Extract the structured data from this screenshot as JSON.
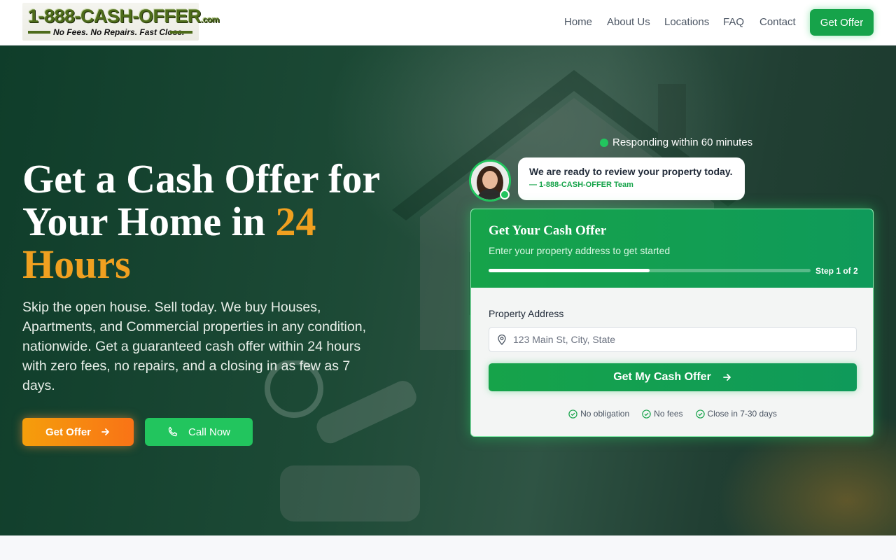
{
  "brand": {
    "logo_main": "1-888-CASH-OFFER",
    "logo_suffix": ".com",
    "logo_tagline": "No Fees. No Repairs. Fast Close."
  },
  "nav": {
    "items": [
      "Home",
      "About Us",
      "Locations",
      "FAQ",
      "Contact"
    ],
    "cta_label": "Get Offer"
  },
  "hero": {
    "title_line1": "Get a Cash Offer for",
    "title_line2_prefix": "Your Home in ",
    "title_highlight_1": "24",
    "title_highlight_2": "Hours",
    "subtitle": "Skip the open house. Sell today. We buy Houses, Apartments, and Commercial properties in any condition, nationwide. Get a guaranteed cash offer within 24 hours with zero fees, no repairs, and a closing in as few as 7 days.",
    "primary_button": "Get Offer",
    "secondary_button": "Call Now",
    "accent_color": "#f0a020"
  },
  "chat": {
    "status_text": "Responding within 60 minutes",
    "message": "We are ready to review your property today.",
    "signature": "— 1-888-CASH-OFFER Team"
  },
  "form": {
    "title": "Get Your Cash Offer",
    "subtitle": "Enter your property address to get started",
    "progress_fraction": 0.5,
    "step_label": "Step 1 of 2",
    "address_label": "Property Address",
    "address_placeholder": "123 Main St, City, State",
    "address_value": "",
    "submit_label": "Get My Cash Offer",
    "perks": [
      "No obligation",
      "No fees",
      "Close in 7-30 days"
    ],
    "brand_color": "#16a34a"
  }
}
